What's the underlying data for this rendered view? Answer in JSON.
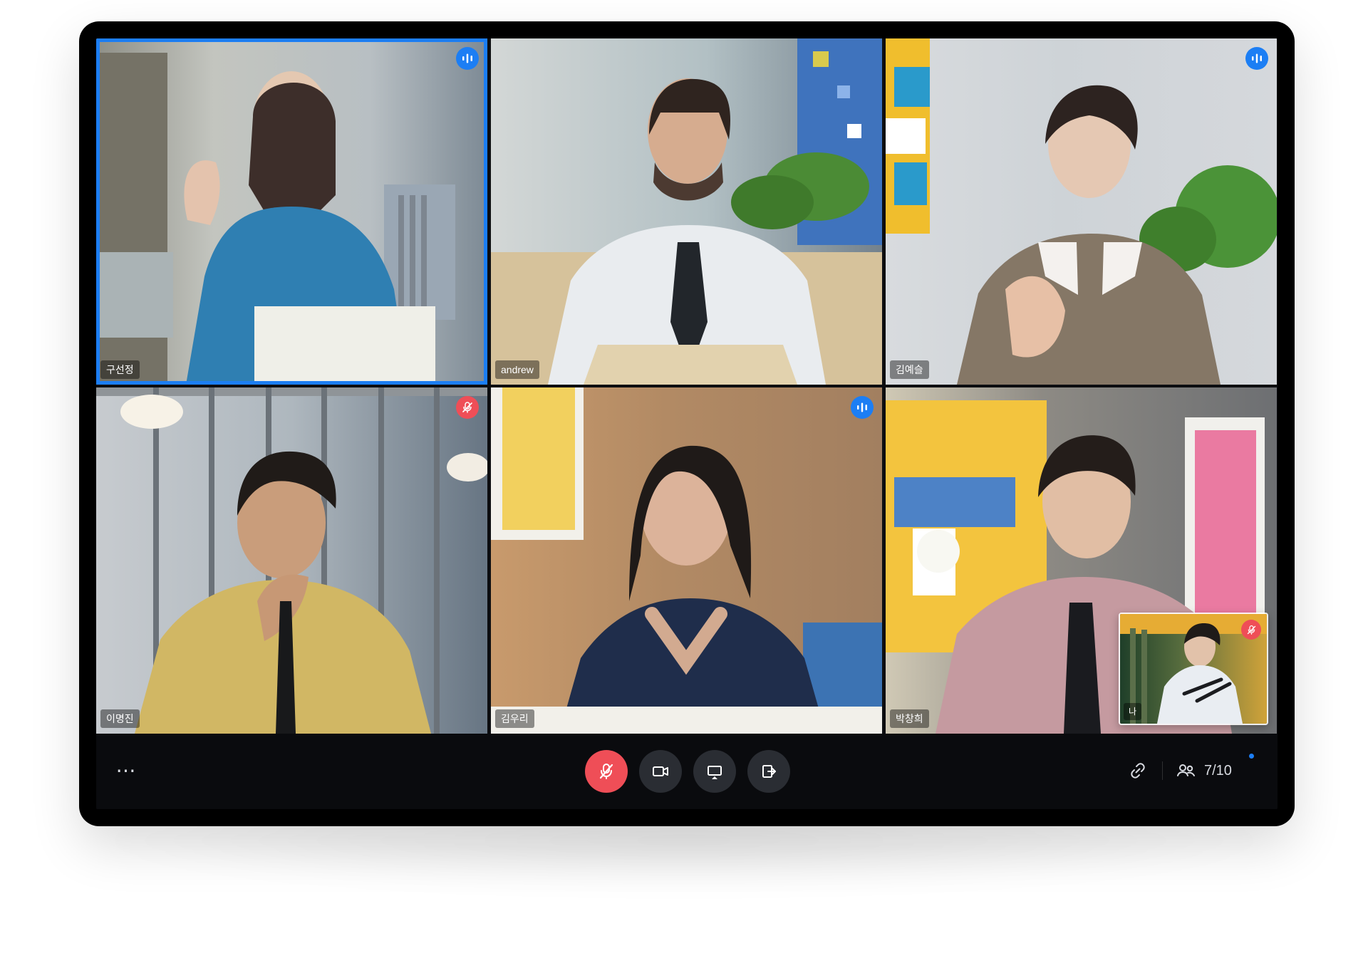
{
  "meeting": {
    "tiles": [
      {
        "name": "구선정",
        "status": "speaking",
        "active": true
      },
      {
        "name": "andrew",
        "status": "none",
        "active": false
      },
      {
        "name": "김예슬",
        "status": "speaking",
        "active": false
      },
      {
        "name": "이명진",
        "status": "muted",
        "active": false
      },
      {
        "name": "김우리",
        "status": "speaking",
        "active": false
      },
      {
        "name": "박창희",
        "status": "none",
        "active": false
      }
    ],
    "self_view": {
      "name": "나",
      "status": "muted"
    }
  },
  "toolbar": {
    "more_label": "⋯",
    "participants_count": "7/10",
    "buttons": {
      "mic": "microphone-off-icon",
      "camera": "camera-icon",
      "share": "screen-share-icon",
      "leave": "leave-icon",
      "link": "link-icon",
      "participants": "people-icon"
    }
  },
  "colors": {
    "active_border": "#1c7ef4",
    "speaking_badge": "#1c7ef4",
    "muted_badge": "#ef4e57",
    "toolbar_bg": "#0a0b0e",
    "mic_button": "#ef4e57"
  }
}
